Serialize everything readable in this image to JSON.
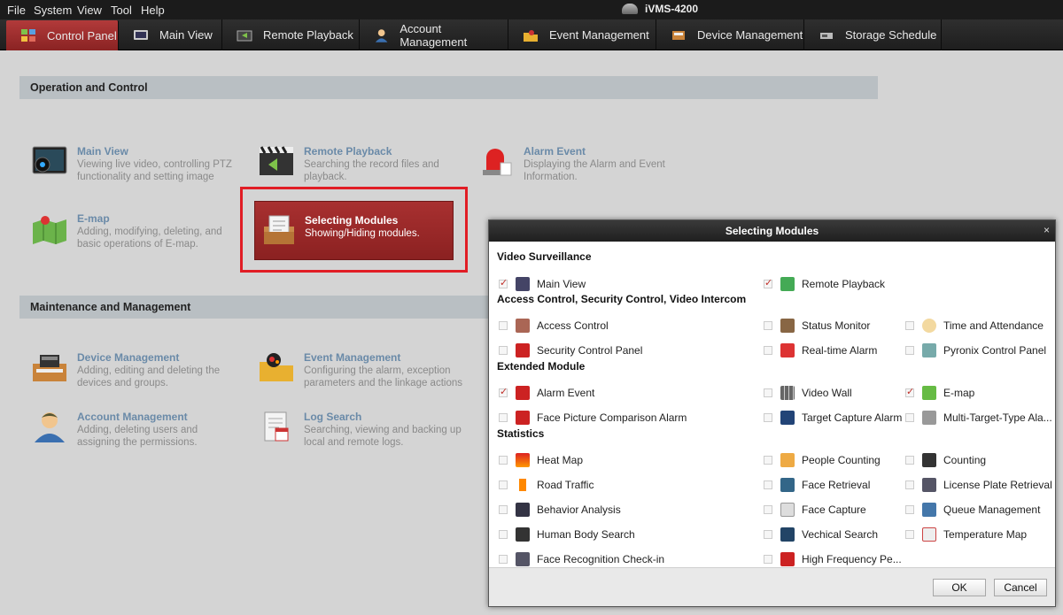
{
  "menu": [
    "File",
    "System",
    "View",
    "Tool",
    "Help"
  ],
  "app_title": "iVMS-4200",
  "tabs": [
    {
      "label": "Control Panel",
      "icon": "control-panel-icon"
    },
    {
      "label": "Main View",
      "icon": "main-view-icon"
    },
    {
      "label": "Remote Playback",
      "icon": "remote-playback-icon"
    },
    {
      "label": "Account Management",
      "icon": "account-icon"
    },
    {
      "label": "Event Management",
      "icon": "event-icon"
    },
    {
      "label": "Device Management",
      "icon": "device-icon"
    },
    {
      "label": "Storage Schedule",
      "icon": "storage-icon"
    }
  ],
  "sections": {
    "operation": "Operation and Control",
    "maintenance": "Maintenance and Management"
  },
  "modules": {
    "main_view": {
      "title": "Main View",
      "desc": "Viewing live video, controlling PTZ functionality and setting image parameters"
    },
    "remote_playback": {
      "title": "Remote Playback",
      "desc": "Searching the record files and playback."
    },
    "alarm_event": {
      "title": "Alarm Event",
      "desc": "Displaying the Alarm and Event Information."
    },
    "emap": {
      "title": "E-map",
      "desc": "Adding, modifying, deleting, and basic operations of E-map."
    },
    "device_mgmt": {
      "title": "Device Management",
      "desc": "Adding, editing and deleting the devices and groups."
    },
    "event_mgmt": {
      "title": "Event Management",
      "desc": "Configuring the alarm, exception parameters and the linkage actions for the devices."
    },
    "account_mgmt": {
      "title": "Account Management",
      "desc": "Adding, deleting users and assigning the permissions."
    },
    "log_search": {
      "title": "Log Search",
      "desc": "Searching, viewing and backing up local and remote logs."
    }
  },
  "selecting_modules": {
    "title": "Selecting Modules",
    "desc": "Showing/Hiding modules."
  },
  "dialog": {
    "title": "Selecting Modules",
    "close": "×",
    "groups": {
      "video": "Video Surveillance",
      "access": "Access Control, Security Control, Video Intercom",
      "extended": "Extended Module",
      "statistics": "Statistics"
    },
    "options": {
      "main_view": "Main View",
      "remote_playback": "Remote Playback",
      "access_control": "Access Control",
      "status_monitor": "Status Monitor",
      "time_attendance": "Time and Attendance",
      "security_control_panel": "Security Control Panel",
      "realtime_alarm": "Real-time Alarm",
      "pyronix": "Pyronix Control Panel",
      "alarm_event": "Alarm Event",
      "video_wall": "Video Wall",
      "emap": "E-map",
      "face_picture": "Face Picture Comparison Alarm",
      "target_capture": "Target Capture Alarm",
      "multi_target": "Multi-Target-Type Ala...",
      "heat_map": "Heat Map",
      "people_counting": "People Counting",
      "counting": "Counting",
      "road_traffic": "Road Traffic",
      "face_retrieval": "Face Retrieval",
      "license_plate": "License Plate Retrieval",
      "behavior_analysis": "Behavior Analysis",
      "face_capture": "Face Capture",
      "queue_management": "Queue Management",
      "human_body_search": "Human Body Search",
      "vehicle_search": "Vechical Search",
      "temperature_map": "Temperature Map",
      "face_recognition_checkin": "Face Recognition Check-in",
      "high_frequency": "High Frequency Pe..."
    },
    "ok": "OK",
    "cancel": "Cancel"
  },
  "colors": {
    "accent": "#a83030",
    "highlight_border": "#e11d25"
  }
}
